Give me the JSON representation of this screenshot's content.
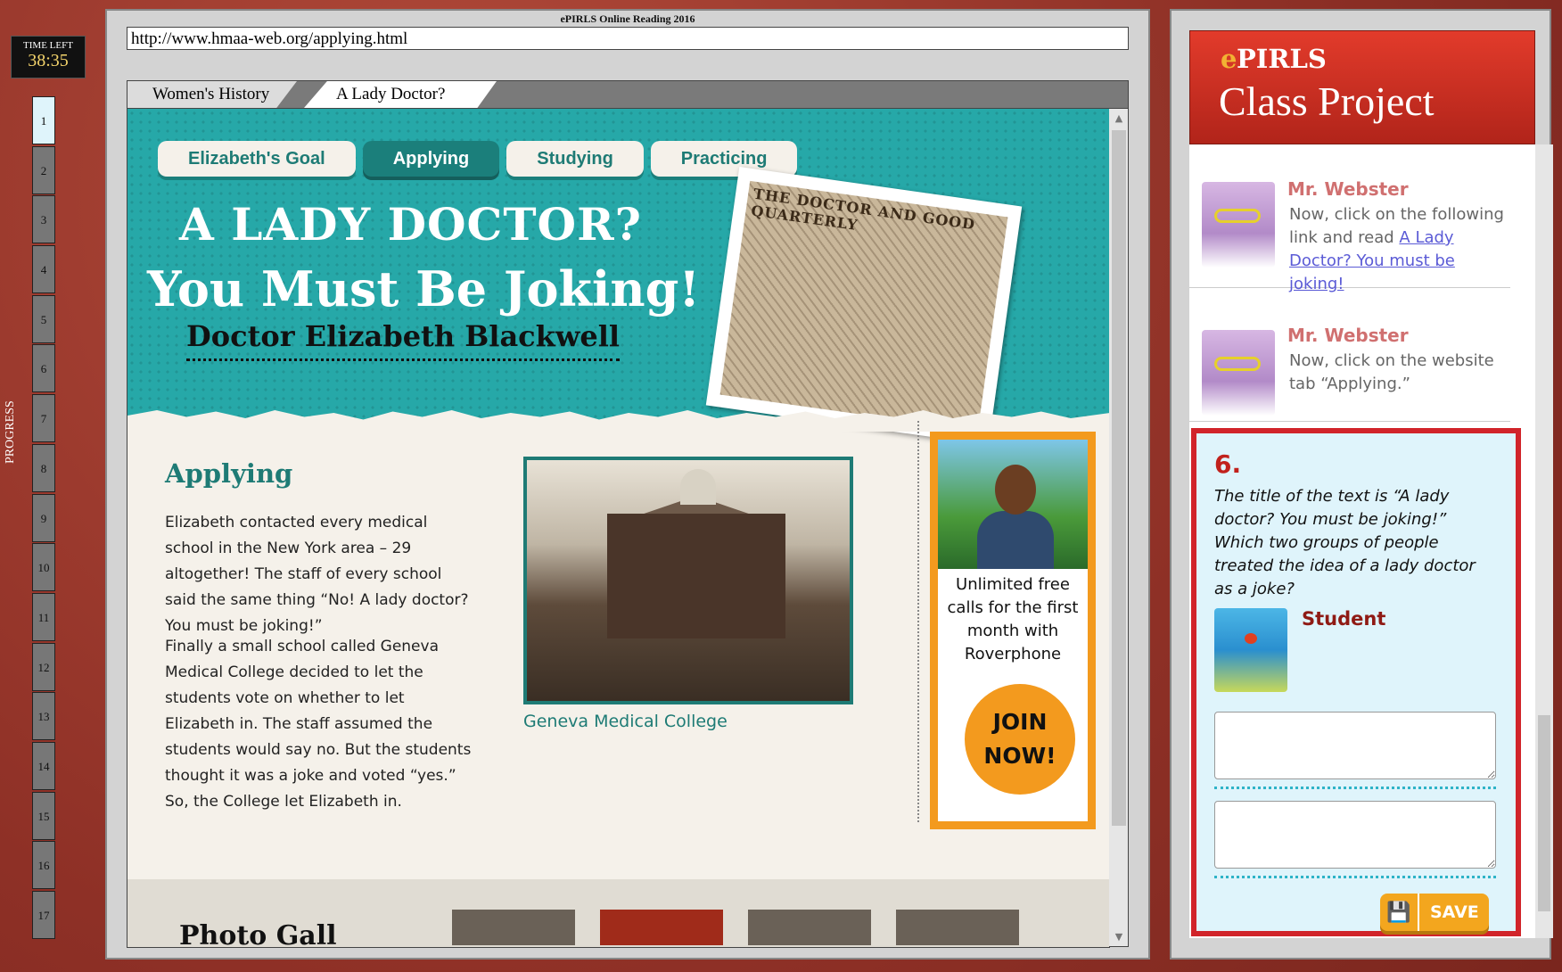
{
  "timer": {
    "label": "TIME LEFT",
    "value": "38:35"
  },
  "progress": {
    "label": "PROGRESS",
    "current": 1,
    "items": [
      "1",
      "2",
      "3",
      "4",
      "5",
      "6",
      "7",
      "8",
      "9",
      "10",
      "11",
      "12",
      "13",
      "14",
      "15",
      "16",
      "17"
    ]
  },
  "browser": {
    "window_title": "ePIRLS Online Reading 2016",
    "url": "http://www.hmaa-web.org/applying.html",
    "tabs": [
      "Women's History",
      "A Lady Doctor?"
    ]
  },
  "site": {
    "nav": [
      "Elizabeth's Goal",
      "Applying",
      "Studying",
      "Practicing"
    ],
    "active_nav": "Applying",
    "headline1": "A LADY DOCTOR?",
    "headline2": "You Must Be Joking!",
    "subheadline": "Doctor Elizabeth Blackwell",
    "magazine_title": "THE DOCTOR AND GOOD QUARTERLY",
    "section_title": "Applying",
    "para1": "Elizabeth contacted every medical school in the New York area – 29 altogether! The staff of every school said the same thing “No! A lady doctor? You must be joking!”",
    "para2": "Finally a small school called Geneva Medical College decided to let the students vote on whether to let Elizabeth in. The staff assumed the students would say no. But the students thought it was a joke and voted “yes.” So, the College let Elizabeth in.",
    "photo_caption": "Geneva Medical College",
    "ad_text": "Unlimited free calls for the first month with Roverphone",
    "ad_button": "JOIN NOW!",
    "gallery_title": "Photo Gall"
  },
  "project": {
    "logo_e": "e",
    "logo_pirls": "PIRLS",
    "title": "Class Project",
    "messages": [
      {
        "from": "Mr. Webster",
        "text_before": "Now, click on the following link and read ",
        "link": "A Lady Doctor? You must be joking!"
      },
      {
        "from": "Mr. Webster",
        "text": "Now, click on the website tab “Applying.”"
      }
    ],
    "question_number": "6.",
    "question_text": "The title of the text is “A lady doctor? You must be joking!” Which two groups of people treated the idea of a lady doctor as a joke?",
    "student_label": "Student",
    "answer1": "",
    "answer2": "",
    "save_label": "SAVE"
  },
  "colors": {
    "teal": "#26a8a8",
    "dark_teal": "#1b7f7b",
    "red": "#d1242a",
    "orange": "#f39a1e"
  }
}
